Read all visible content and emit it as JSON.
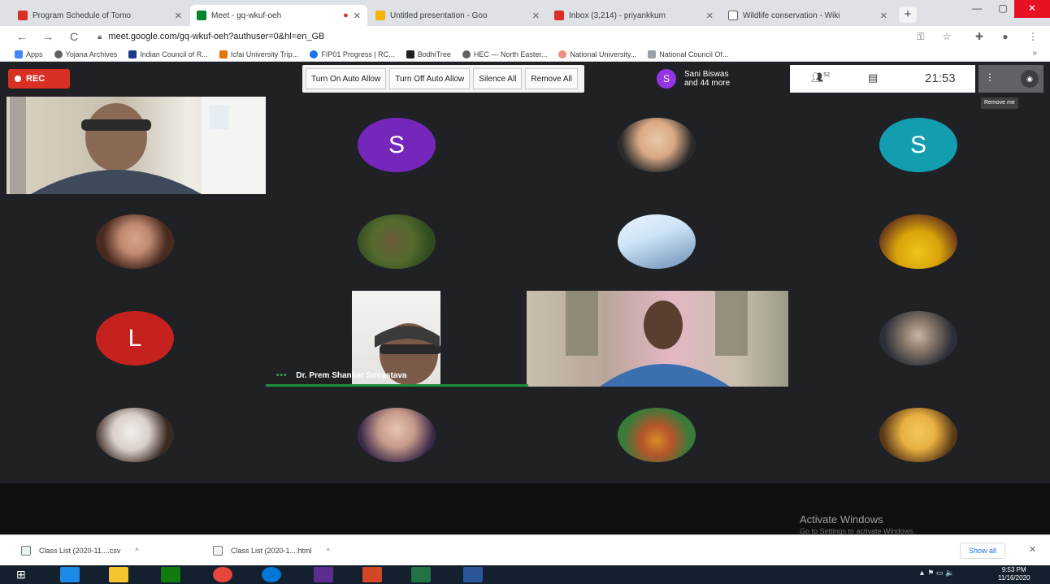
{
  "browser": {
    "tabs": [
      {
        "label": "Program Schedule of Tomo",
        "active": false,
        "favicon_color": "#d93025"
      },
      {
        "label": "Meet - gq-wkuf-oeh",
        "active": true,
        "favicon_color": "#00832d"
      },
      {
        "label": "Untitled presentation - Goo",
        "active": false,
        "favicon_color": "#f4b400"
      },
      {
        "label": "Inbox (3,214) - priyankkum",
        "active": false,
        "favicon_color": "#d93025"
      },
      {
        "label": "Wildlife conservation - Wiki",
        "active": false,
        "favicon_color": "#5f6368"
      }
    ],
    "new_tab_label": "+",
    "window_controls": {
      "minimize": "—",
      "maximize": "▢",
      "close": "✕"
    },
    "nav": {
      "back": "←",
      "forward": "→",
      "reload": "C"
    },
    "url": "meet.google.com/gq-wkuf-oeh?authuser=0&hl=en_GB",
    "toolbar_icons": {
      "key": "⚿",
      "star": "☆",
      "extensions": "✚",
      "profile": "●",
      "menu": "⋮"
    },
    "bookmarks": [
      "Apps",
      "Yojana Archives",
      "Indian Council of R...",
      "Icfai University Trip...",
      "FIP01 Progress | RC...",
      "BodhiTree",
      "HEC — North Easter...",
      "National University...",
      "National Council Of..."
    ],
    "bookmarks_more": "»"
  },
  "meet": {
    "rec_label": "REC",
    "controls": [
      "Turn On Auto Allow",
      "Turn Off Auto Allow",
      "Silence All",
      "Remove All"
    ],
    "presenter": {
      "initial": "S",
      "line1": "Sani Biswas",
      "line2": "and 44 more"
    },
    "people_count": "52",
    "clock": "21:53",
    "tooltip": "Remove me",
    "speaker_name": "Dr. Prem Shankar Srivastava",
    "speaker_dots": "•••",
    "participants": [
      {
        "kind": "video",
        "name": "participant-video-1"
      },
      {
        "kind": "letter",
        "letter": "S",
        "color": "#7627bb"
      },
      {
        "kind": "photo",
        "colors": [
          "#e8c8a8",
          "#2b2b2b"
        ]
      },
      {
        "kind": "letter",
        "letter": "S",
        "color": "#129eaf"
      },
      {
        "kind": "photo",
        "colors": [
          "#d6a48a",
          "#4a2a20"
        ]
      },
      {
        "kind": "photo",
        "colors": [
          "#6b5a3a",
          "#2f4a1e"
        ]
      },
      {
        "kind": "photo",
        "colors": [
          "#cfe4f7",
          "#6a8fb5"
        ]
      },
      {
        "kind": "photo",
        "colors": [
          "#f0c419",
          "#6b3a1a"
        ]
      },
      {
        "kind": "letter",
        "letter": "L",
        "color": "#c5221f"
      },
      {
        "kind": "video",
        "name": "participant-video-2"
      },
      {
        "kind": "video",
        "name": "participant-video-3"
      },
      {
        "kind": "photo",
        "colors": [
          "#c9b8a8",
          "#2b2f3a"
        ]
      },
      {
        "kind": "photo",
        "colors": [
          "#e9e4e0",
          "#3a2a22"
        ]
      },
      {
        "kind": "photo",
        "colors": [
          "#d8b4a4",
          "#3a2a4a"
        ]
      },
      {
        "kind": "photo",
        "colors": [
          "#3a7a3a",
          "#d88a2a"
        ]
      },
      {
        "kind": "photo",
        "colors": [
          "#e8b040",
          "#5a3a18"
        ]
      }
    ],
    "watermark_line1": "Activate Windows",
    "watermark_line2": "Go to Settings to activate Windows."
  },
  "downloads": {
    "items": [
      "Class List (2020-11....csv",
      "Class List (2020-1....html"
    ],
    "chevron": "^",
    "show_all": "Show all",
    "close": "✕"
  },
  "taskbar": {
    "start": "⊞",
    "tray": "▲ ⚑ ▭ 🔈",
    "time": "9:53 PM",
    "date": "11/16/2020"
  }
}
